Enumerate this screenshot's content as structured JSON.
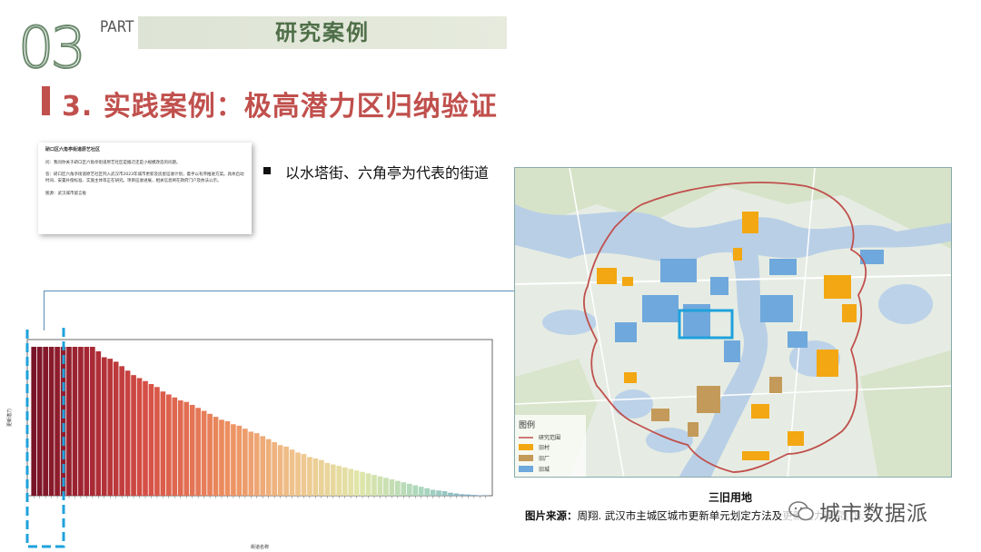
{
  "header": {
    "section_number": "03",
    "part_label": "PART",
    "section_title": "研究案例"
  },
  "slide_title": "3. 实践案例：极高潜力区归纳验证",
  "doc_card": {
    "heading": "硚口区六角亭街道原艺社区",
    "paragraph_1": "问：我问你关于硚口区六角亭街道原艺社区是搬迁还是小规模改造的问题。",
    "paragraph_2": "答：硚口区六角亭街道原艺社区列入武汉市2023年城市更新及房屋征收计划，着手以有序推进方案。具体启动时间、安置补偿标准、实施主体等正在研究。项目征收进展，相关信息将在政府门户及依法公示。",
    "paragraph_3": "图源：武汉城市留言板"
  },
  "bullet": "以水塔街、六角亭为代表的街道",
  "map": {
    "caption": "三旧用地",
    "legend_title": "图例",
    "legend_items": [
      {
        "label": "研究范围",
        "color": "#c0504d"
      },
      {
        "label": "旧村",
        "color": "#f3a712"
      },
      {
        "label": "旧厂",
        "color": "#c49a5a"
      },
      {
        "label": "旧城",
        "color": "#6fa8dc"
      }
    ]
  },
  "source": {
    "label": "图片来源：",
    "text": "周翔. 武汉市主城区城市更新单元划定方法及更新潜力研究[D]."
  },
  "watermark": "城市数据派",
  "colors": {
    "accent_red": "#c0504d",
    "header_green": "#4f6f48",
    "highlight_blue": "#1fa2dc"
  },
  "chart_data": {
    "type": "bar",
    "xlabel": "街道名称",
    "ylabel": "更新潜力",
    "ylim": [
      0,
      1
    ],
    "values": [
      1,
      1,
      1,
      1,
      1,
      1,
      1,
      1,
      1,
      1,
      1,
      0.97,
      0.93,
      0.92,
      0.9,
      0.87,
      0.84,
      0.81,
      0.79,
      0.77,
      0.75,
      0.73,
      0.7,
      0.68,
      0.66,
      0.64,
      0.63,
      0.61,
      0.59,
      0.57,
      0.55,
      0.53,
      0.51,
      0.5,
      0.48,
      0.47,
      0.45,
      0.43,
      0.42,
      0.4,
      0.38,
      0.36,
      0.34,
      0.33,
      0.31,
      0.29,
      0.28,
      0.26,
      0.25,
      0.24,
      0.22,
      0.21,
      0.2,
      0.19,
      0.18,
      0.17,
      0.16,
      0.15,
      0.14,
      0.13,
      0.12,
      0.11,
      0.1,
      0.09,
      0.08,
      0.07,
      0.06,
      0.05,
      0.04,
      0.035,
      0.03,
      0.02,
      0.015,
      0.01,
      0.008,
      0.005,
      0.003,
      0.002
    ],
    "grid": false,
    "legend": "none"
  }
}
